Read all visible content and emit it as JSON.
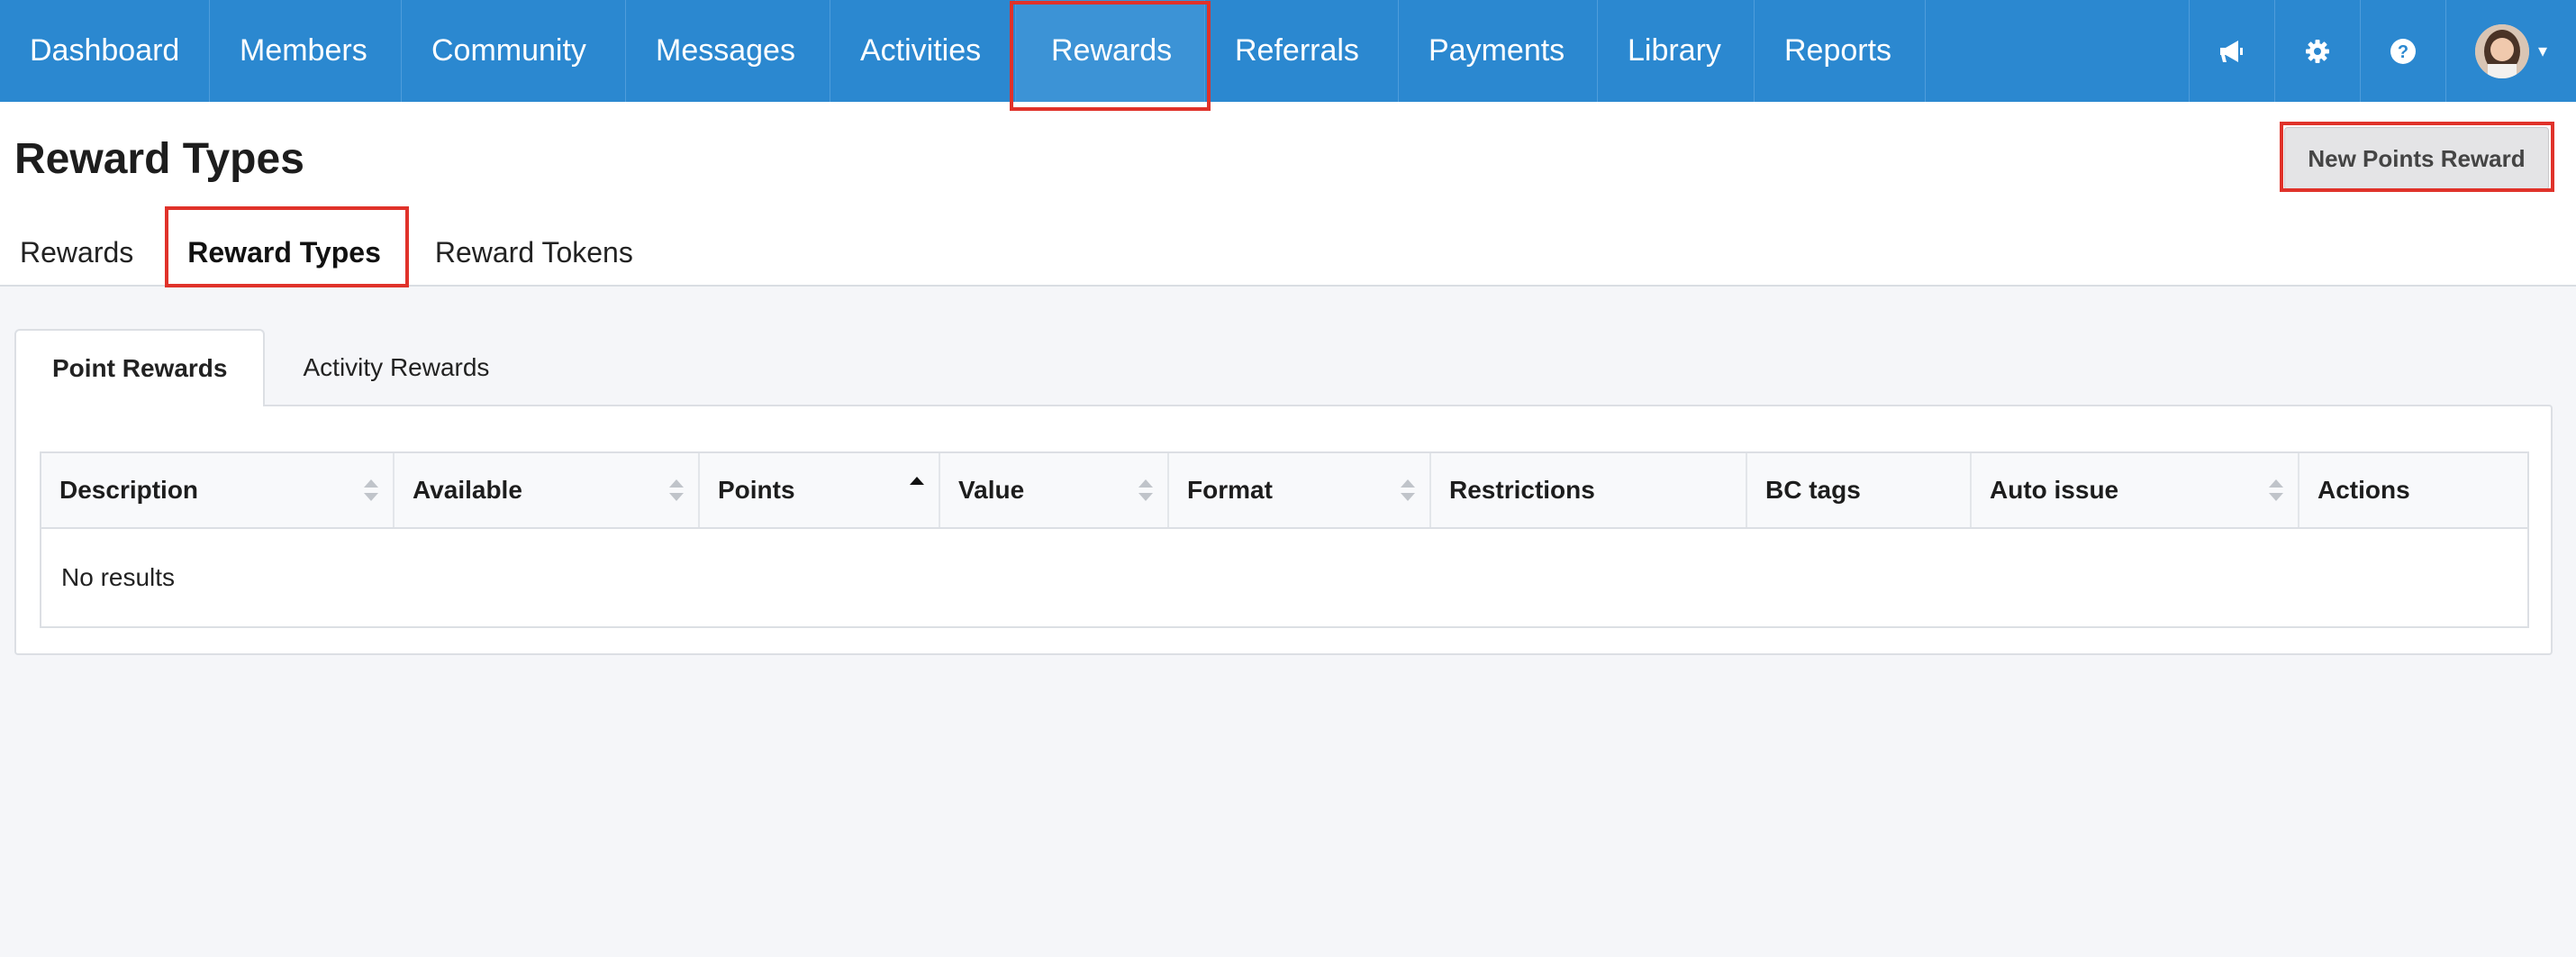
{
  "nav": {
    "items": [
      {
        "label": "Dashboard",
        "active": false
      },
      {
        "label": "Members",
        "active": false
      },
      {
        "label": "Community",
        "active": false
      },
      {
        "label": "Messages",
        "active": false
      },
      {
        "label": "Activities",
        "active": false
      },
      {
        "label": "Rewards",
        "active": true
      },
      {
        "label": "Referrals",
        "active": false
      },
      {
        "label": "Payments",
        "active": false
      },
      {
        "label": "Library",
        "active": false
      },
      {
        "label": "Reports",
        "active": false
      }
    ],
    "icons": [
      "megaphone-icon",
      "gear-icon",
      "help-icon"
    ],
    "avatar_caret": "▾",
    "color": "#2b88d0"
  },
  "page": {
    "title": "Reward Types",
    "primary_button": "New Points Reward"
  },
  "subtabs": [
    {
      "label": "Rewards",
      "active": false
    },
    {
      "label": "Reward Types",
      "active": true
    },
    {
      "label": "Reward Tokens",
      "active": false
    }
  ],
  "content_tabs": [
    {
      "label": "Point Rewards",
      "active": true
    },
    {
      "label": "Activity Rewards",
      "active": false
    }
  ],
  "table": {
    "columns": [
      {
        "label": "Description",
        "sort": "none"
      },
      {
        "label": "Available",
        "sort": "none"
      },
      {
        "label": "Points",
        "sort": "asc"
      },
      {
        "label": "Value",
        "sort": "none"
      },
      {
        "label": "Format",
        "sort": "none"
      },
      {
        "label": "Restrictions",
        "sort": "unsortable"
      },
      {
        "label": "BC tags",
        "sort": "unsortable"
      },
      {
        "label": "Auto issue",
        "sort": "none"
      },
      {
        "label": "Actions",
        "sort": "unsortable"
      }
    ],
    "empty_text": "No results"
  },
  "highlight_color": "#e0322a"
}
